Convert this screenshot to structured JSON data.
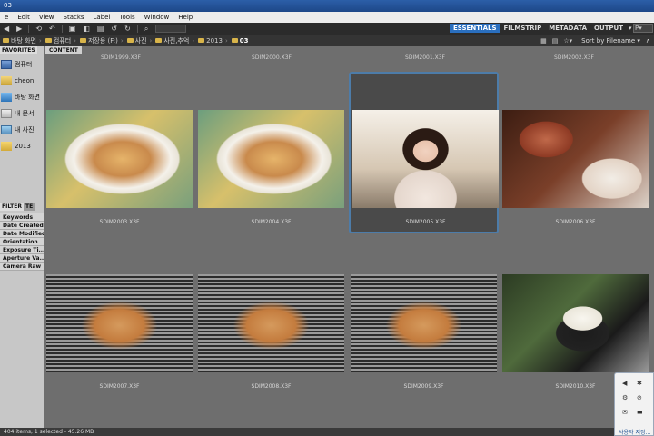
{
  "window": {
    "title": "03"
  },
  "menu": {
    "items": [
      "e",
      "Edit",
      "View",
      "Stacks",
      "Label",
      "Tools",
      "Window",
      "Help"
    ]
  },
  "toolbar": {
    "workspaces": [
      "ESSENTIALS",
      "FILMSTRIP",
      "METADATA",
      "OUTPUT"
    ],
    "active_workspace": "ESSENTIALS",
    "workspace_dropdown": "▾",
    "search_placeholder": "P▾"
  },
  "path": {
    "crumbs": [
      "바탕 화면",
      "컴퓨터",
      "저장용 (F:)",
      "사진",
      "사진,추억",
      "2013",
      "03"
    ],
    "sort_label": "Sort by Filename ▾"
  },
  "left_panel": {
    "tabs": [
      "FAVORITES"
    ],
    "favorites": [
      "컴퓨터",
      "cheon",
      "바탕 화면",
      "내 문서",
      "내 사진",
      "2013"
    ],
    "filter_tabs": [
      "FILTER",
      "TE"
    ],
    "filters": [
      "Keywords",
      "Date Created",
      "Date Modified",
      "Orientation",
      "Exposure Ti...",
      "Aperture Va...",
      "Camera Raw"
    ]
  },
  "content": {
    "tab": "CONTENT",
    "top_row_labels": [
      "SDIM1999.X3F",
      "SDIM2000.X3F",
      "SDIM2001.X3F",
      "SDIM2002.X3F"
    ],
    "thumbnails": [
      {
        "name": "SDIM2003.X3F",
        "kind": "pizza",
        "selected": false
      },
      {
        "name": "SDIM2004.X3F",
        "kind": "pizza",
        "selected": false
      },
      {
        "name": "SDIM2005.X3F",
        "kind": "portrait",
        "selected": true
      },
      {
        "name": "SDIM2006.X3F",
        "kind": "meal",
        "selected": false
      },
      {
        "name": "SDIM2007.X3F",
        "kind": "grill",
        "selected": false
      },
      {
        "name": "SDIM2008.X3F",
        "kind": "grill",
        "selected": false
      },
      {
        "name": "SDIM2009.X3F",
        "kind": "grill",
        "selected": false
      },
      {
        "name": "SDIM2010.X3F",
        "kind": "sides",
        "selected": false
      }
    ]
  },
  "status": {
    "text": "404 items, 1 selected - 45.26 MB"
  },
  "popup": {
    "text": "사용자 지정..."
  }
}
